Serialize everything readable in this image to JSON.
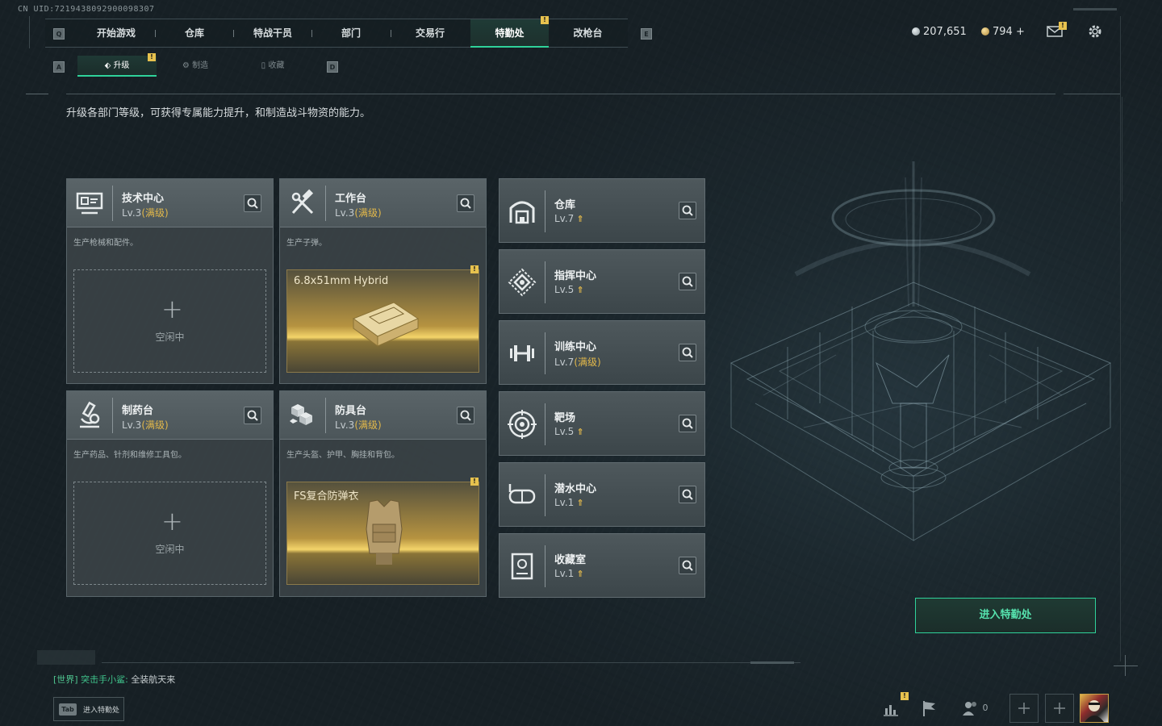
{
  "uid": "CN UID:7219438092900098307",
  "nav": {
    "key_left": "Q",
    "key_right": "E",
    "tabs": [
      {
        "label": "开始游戏"
      },
      {
        "label": "仓库"
      },
      {
        "label": "特战干员"
      },
      {
        "label": "部门"
      },
      {
        "label": "交易行"
      },
      {
        "label": "特勤处"
      },
      {
        "label": "改枪台"
      }
    ],
    "active_tab": "特勤处",
    "badge": "!"
  },
  "currency": {
    "silver": "207,651",
    "gold": "794",
    "gold_add": "+"
  },
  "subnav": {
    "key_left": "A",
    "key_right": "D",
    "tabs": [
      {
        "label": "升级"
      },
      {
        "label": "制造"
      },
      {
        "label": "收藏"
      }
    ],
    "badge": "!"
  },
  "description": "升级各部门等级，可获得专属能力提升，和制造战斗物资的能力。",
  "workbenches": [
    {
      "name": "技术中心",
      "level": "Lv.3",
      "max": "(满级)",
      "desc": "生产枪械和配件。",
      "icon": "computer-icon",
      "slot": {
        "state": "idle",
        "plus": "+",
        "label": "空闲中"
      }
    },
    {
      "name": "工作台",
      "level": "Lv.3",
      "max": "(满级)",
      "desc": "生产子弹。",
      "icon": "hammer-wrench-icon",
      "slot": {
        "state": "producing",
        "item": "6.8x51mm Hybrid",
        "badge": "!"
      }
    },
    {
      "name": "制药台",
      "level": "Lv.3",
      "max": "(满级)",
      "desc": "生产药品、针剂和维修工具包。",
      "icon": "microscope-icon",
      "slot": {
        "state": "idle",
        "plus": "+",
        "label": "空闲中"
      }
    },
    {
      "name": "防具台",
      "level": "Lv.3",
      "max": "(满级)",
      "desc": "生产头盔、护甲、胸挂和背包。",
      "icon": "cubes-icon",
      "slot": {
        "state": "producing",
        "item": "FS复合防弹衣",
        "badge": "!"
      }
    }
  ],
  "facilities": [
    {
      "name": "仓库",
      "level": "Lv.7",
      "upgradable": true,
      "icon": "warehouse-icon"
    },
    {
      "name": "指挥中心",
      "level": "Lv.5",
      "upgradable": true,
      "icon": "command-center-icon"
    },
    {
      "name": "训练中心",
      "level": "Lv.7",
      "max": "(满级)",
      "upgradable": false,
      "icon": "dumbbell-icon"
    },
    {
      "name": "靶场",
      "level": "Lv.5",
      "upgradable": true,
      "icon": "target-icon"
    },
    {
      "name": "潜水中心",
      "level": "Lv.1",
      "upgradable": true,
      "icon": "diving-mask-icon"
    },
    {
      "name": "收藏室",
      "level": "Lv.1",
      "upgradable": true,
      "icon": "collection-icon"
    }
  ],
  "up_glyph": "⇑",
  "enter_button": "进入特勤处",
  "chat": {
    "channel": "[世界]",
    "name": "突击手小鲨:",
    "message": "全装航天来"
  },
  "tab_hint": {
    "key": "Tab",
    "label": "进入特勤处"
  },
  "bottom": {
    "friends_count": "0",
    "badge": "!"
  },
  "colors": {
    "accent": "#2fd29a",
    "gold": "#e2b84a",
    "badge": "#e7c24e"
  }
}
